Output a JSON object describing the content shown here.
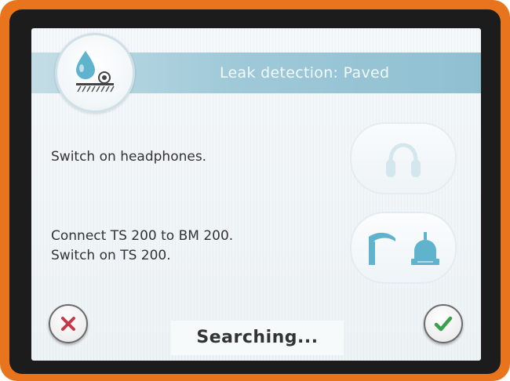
{
  "header": {
    "title": "Leak detection: Paved",
    "mode_icon": "leak-paved-icon"
  },
  "steps": [
    {
      "text_line1": "Switch on headphones.",
      "icon": "headphones-icon"
    },
    {
      "text_line1": "Connect TS 200 to BM 200.",
      "text_line2": "Switch on TS 200.",
      "icon": "sensor-devices-icon"
    }
  ],
  "buttons": {
    "cancel_icon": "close-icon",
    "confirm_icon": "check-icon"
  },
  "status": {
    "text": "Searching..."
  },
  "colors": {
    "frame": "#e8741e",
    "bezel": "#1c1c1c",
    "accent": "#5fb3cc",
    "cancel": "#c43a4a",
    "confirm": "#3aa14a"
  }
}
